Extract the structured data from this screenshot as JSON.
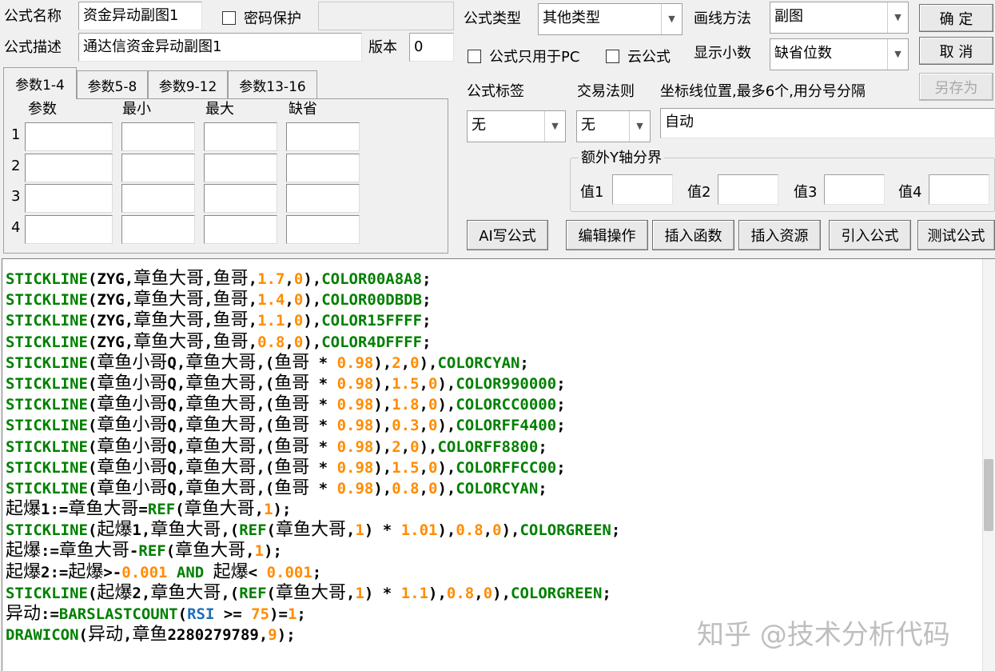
{
  "formula": {
    "name_label": "公式名称",
    "name_value": "资金异动副图1",
    "password_label": "密码保护",
    "password_value": "",
    "desc_label": "公式描述",
    "desc_value": "通达信资金异动副图1",
    "version_label": "版本",
    "version_value": "0"
  },
  "right_panel": {
    "type_label": "公式类型",
    "type_value": "其他类型",
    "draw_label": "画线方法",
    "draw_value": "副图",
    "pc_only_label": "公式只用于PC",
    "cloud_label": "云公式",
    "decimals_label": "显示小数",
    "decimals_value": "缺省位数",
    "tag_label": "公式标签",
    "tag_value": "无",
    "rule_label": "交易法则",
    "rule_value": "无",
    "axis_label": "坐标线位置,最多6个,用分号分隔",
    "axis_value": "自动",
    "extra_y_label": "额外Y轴分界",
    "val1": "值1",
    "val2": "值2",
    "val3": "值3",
    "val4": "值4"
  },
  "buttons": {
    "ok": "确  定",
    "cancel": "取  消",
    "save_as": "另存为",
    "ai": "AI写公式",
    "edit_ops": "编辑操作",
    "insert_func": "插入函数",
    "insert_res": "插入资源",
    "import": "引入公式",
    "test": "测试公式"
  },
  "tabs": [
    "参数1-4",
    "参数5-8",
    "参数9-12",
    "参数13-16"
  ],
  "params": {
    "headers": [
      "参数",
      "最小",
      "最大",
      "缺省"
    ],
    "rows": [
      "1",
      "2",
      "3",
      "4"
    ]
  },
  "code_lines": [
    [
      [
        "fn",
        "STICKLINE"
      ],
      [
        "sym",
        "(ZYG,"
      ],
      [
        "cn",
        "章鱼大哥"
      ],
      [
        "sym",
        ","
      ],
      [
        "cn",
        "鱼哥"
      ],
      [
        "sym",
        ","
      ],
      [
        "num",
        "1.7"
      ],
      [
        "sym",
        ","
      ],
      [
        "num",
        "0"
      ],
      [
        "sym",
        "),"
      ],
      [
        "fn",
        "COLOR00A8A8"
      ],
      [
        "sym",
        ";"
      ]
    ],
    [
      [
        "fn",
        "STICKLINE"
      ],
      [
        "sym",
        "(ZYG,"
      ],
      [
        "cn",
        "章鱼大哥"
      ],
      [
        "sym",
        ","
      ],
      [
        "cn",
        "鱼哥"
      ],
      [
        "sym",
        ","
      ],
      [
        "num",
        "1.4"
      ],
      [
        "sym",
        ","
      ],
      [
        "num",
        "0"
      ],
      [
        "sym",
        "),"
      ],
      [
        "fn",
        "COLOR00DBDB"
      ],
      [
        "sym",
        ";"
      ]
    ],
    [
      [
        "fn",
        "STICKLINE"
      ],
      [
        "sym",
        "(ZYG,"
      ],
      [
        "cn",
        "章鱼大哥"
      ],
      [
        "sym",
        ","
      ],
      [
        "cn",
        "鱼哥"
      ],
      [
        "sym",
        ","
      ],
      [
        "num",
        "1.1"
      ],
      [
        "sym",
        ","
      ],
      [
        "num",
        "0"
      ],
      [
        "sym",
        "),"
      ],
      [
        "fn",
        "COLOR15FFFF"
      ],
      [
        "sym",
        ";"
      ]
    ],
    [
      [
        "fn",
        "STICKLINE"
      ],
      [
        "sym",
        "(ZYG,"
      ],
      [
        "cn",
        "章鱼大哥"
      ],
      [
        "sym",
        ","
      ],
      [
        "cn",
        "鱼哥"
      ],
      [
        "sym",
        ","
      ],
      [
        "num",
        "0.8"
      ],
      [
        "sym",
        ","
      ],
      [
        "num",
        "0"
      ],
      [
        "sym",
        "),"
      ],
      [
        "fn",
        "COLOR4DFFFF"
      ],
      [
        "sym",
        ";"
      ]
    ],
    [
      [
        "fn",
        "STICKLINE"
      ],
      [
        "sym",
        "("
      ],
      [
        "cn",
        "章鱼小哥"
      ],
      [
        "sym",
        "Q,"
      ],
      [
        "cn",
        "章鱼大哥"
      ],
      [
        "sym",
        ",("
      ],
      [
        "cn",
        "鱼哥"
      ],
      [
        "sym",
        " * "
      ],
      [
        "num",
        "0.98"
      ],
      [
        "sym",
        "),"
      ],
      [
        "num",
        "2"
      ],
      [
        "sym",
        ","
      ],
      [
        "num",
        "0"
      ],
      [
        "sym",
        "),"
      ],
      [
        "fn",
        "COLORCYAN"
      ],
      [
        "sym",
        ";"
      ]
    ],
    [
      [
        "fn",
        "STICKLINE"
      ],
      [
        "sym",
        "("
      ],
      [
        "cn",
        "章鱼小哥"
      ],
      [
        "sym",
        "Q,"
      ],
      [
        "cn",
        "章鱼大哥"
      ],
      [
        "sym",
        ",("
      ],
      [
        "cn",
        "鱼哥"
      ],
      [
        "sym",
        " * "
      ],
      [
        "num",
        "0.98"
      ],
      [
        "sym",
        "),"
      ],
      [
        "num",
        "1.5"
      ],
      [
        "sym",
        ","
      ],
      [
        "num",
        "0"
      ],
      [
        "sym",
        "),"
      ],
      [
        "fn",
        "COLOR990000"
      ],
      [
        "sym",
        ";"
      ]
    ],
    [
      [
        "fn",
        "STICKLINE"
      ],
      [
        "sym",
        "("
      ],
      [
        "cn",
        "章鱼小哥"
      ],
      [
        "sym",
        "Q,"
      ],
      [
        "cn",
        "章鱼大哥"
      ],
      [
        "sym",
        ",("
      ],
      [
        "cn",
        "鱼哥"
      ],
      [
        "sym",
        " * "
      ],
      [
        "num",
        "0.98"
      ],
      [
        "sym",
        "),"
      ],
      [
        "num",
        "1.8"
      ],
      [
        "sym",
        ","
      ],
      [
        "num",
        "0"
      ],
      [
        "sym",
        "),"
      ],
      [
        "fn",
        "COLORCC0000"
      ],
      [
        "sym",
        ";"
      ]
    ],
    [
      [
        "fn",
        "STICKLINE"
      ],
      [
        "sym",
        "("
      ],
      [
        "cn",
        "章鱼小哥"
      ],
      [
        "sym",
        "Q,"
      ],
      [
        "cn",
        "章鱼大哥"
      ],
      [
        "sym",
        ",("
      ],
      [
        "cn",
        "鱼哥"
      ],
      [
        "sym",
        " * "
      ],
      [
        "num",
        "0.98"
      ],
      [
        "sym",
        "),"
      ],
      [
        "num",
        "0.3"
      ],
      [
        "sym",
        ","
      ],
      [
        "num",
        "0"
      ],
      [
        "sym",
        "),"
      ],
      [
        "fn",
        "COLORFF4400"
      ],
      [
        "sym",
        ";"
      ]
    ],
    [
      [
        "fn",
        "STICKLINE"
      ],
      [
        "sym",
        "("
      ],
      [
        "cn",
        "章鱼小哥"
      ],
      [
        "sym",
        "Q,"
      ],
      [
        "cn",
        "章鱼大哥"
      ],
      [
        "sym",
        ",("
      ],
      [
        "cn",
        "鱼哥"
      ],
      [
        "sym",
        " * "
      ],
      [
        "num",
        "0.98"
      ],
      [
        "sym",
        "),"
      ],
      [
        "num",
        "2"
      ],
      [
        "sym",
        ","
      ],
      [
        "num",
        "0"
      ],
      [
        "sym",
        "),"
      ],
      [
        "fn",
        "COLORFF8800"
      ],
      [
        "sym",
        ";"
      ]
    ],
    [
      [
        "fn",
        "STICKLINE"
      ],
      [
        "sym",
        "("
      ],
      [
        "cn",
        "章鱼小哥"
      ],
      [
        "sym",
        "Q,"
      ],
      [
        "cn",
        "章鱼大哥"
      ],
      [
        "sym",
        ",("
      ],
      [
        "cn",
        "鱼哥"
      ],
      [
        "sym",
        " * "
      ],
      [
        "num",
        "0.98"
      ],
      [
        "sym",
        "),"
      ],
      [
        "num",
        "1.5"
      ],
      [
        "sym",
        ","
      ],
      [
        "num",
        "0"
      ],
      [
        "sym",
        "),"
      ],
      [
        "fn",
        "COLORFFCC00"
      ],
      [
        "sym",
        ";"
      ]
    ],
    [
      [
        "fn",
        "STICKLINE"
      ],
      [
        "sym",
        "("
      ],
      [
        "cn",
        "章鱼小哥"
      ],
      [
        "sym",
        "Q,"
      ],
      [
        "cn",
        "章鱼大哥"
      ],
      [
        "sym",
        ",("
      ],
      [
        "cn",
        "鱼哥"
      ],
      [
        "sym",
        " * "
      ],
      [
        "num",
        "0.98"
      ],
      [
        "sym",
        "),"
      ],
      [
        "num",
        "0.8"
      ],
      [
        "sym",
        ","
      ],
      [
        "num",
        "0"
      ],
      [
        "sym",
        "),"
      ],
      [
        "fn",
        "COLORCYAN"
      ],
      [
        "sym",
        ";"
      ]
    ],
    [
      [
        "cn",
        "起爆"
      ],
      [
        "sym",
        "1:="
      ],
      [
        "cn",
        "章鱼大哥"
      ],
      [
        "sym",
        "="
      ],
      [
        "fn",
        "REF"
      ],
      [
        "sym",
        "("
      ],
      [
        "cn",
        "章鱼大哥"
      ],
      [
        "sym",
        ","
      ],
      [
        "num",
        "1"
      ],
      [
        "sym",
        ");"
      ]
    ],
    [
      [
        "fn",
        "STICKLINE"
      ],
      [
        "sym",
        "("
      ],
      [
        "cn",
        "起爆"
      ],
      [
        "sym",
        "1,"
      ],
      [
        "cn",
        "章鱼大哥"
      ],
      [
        "sym",
        ",("
      ],
      [
        "fn",
        "REF"
      ],
      [
        "sym",
        "("
      ],
      [
        "cn",
        "章鱼大哥"
      ],
      [
        "sym",
        ","
      ],
      [
        "num",
        "1"
      ],
      [
        "sym",
        ") * "
      ],
      [
        "num",
        "1.01"
      ],
      [
        "sym",
        "),"
      ],
      [
        "num",
        "0.8"
      ],
      [
        "sym",
        ","
      ],
      [
        "num",
        "0"
      ],
      [
        "sym",
        "),"
      ],
      [
        "fn",
        "COLORGREEN"
      ],
      [
        "sym",
        ";"
      ]
    ],
    [
      [
        "cn",
        "起爆"
      ],
      [
        "sym",
        ":="
      ],
      [
        "cn",
        "章鱼大哥"
      ],
      [
        "sym",
        "-"
      ],
      [
        "fn",
        "REF"
      ],
      [
        "sym",
        "("
      ],
      [
        "cn",
        "章鱼大哥"
      ],
      [
        "sym",
        ","
      ],
      [
        "num",
        "1"
      ],
      [
        "sym",
        ");"
      ]
    ],
    [
      [
        "cn",
        "起爆"
      ],
      [
        "sym",
        "2:="
      ],
      [
        "cn",
        "起爆"
      ],
      [
        "sym",
        ">-"
      ],
      [
        "num",
        "0.001"
      ],
      [
        "fn",
        " AND "
      ],
      [
        "cn",
        "起爆"
      ],
      [
        "sym",
        "< "
      ],
      [
        "num",
        "0.001"
      ],
      [
        "sym",
        ";"
      ]
    ],
    [
      [
        "fn",
        "STICKLINE"
      ],
      [
        "sym",
        "("
      ],
      [
        "cn",
        "起爆"
      ],
      [
        "sym",
        "2,"
      ],
      [
        "cn",
        "章鱼大哥"
      ],
      [
        "sym",
        ",("
      ],
      [
        "fn",
        "REF"
      ],
      [
        "sym",
        "("
      ],
      [
        "cn",
        "章鱼大哥"
      ],
      [
        "sym",
        ","
      ],
      [
        "num",
        "1"
      ],
      [
        "sym",
        ") * "
      ],
      [
        "num",
        "1.1"
      ],
      [
        "sym",
        "),"
      ],
      [
        "num",
        "0.8"
      ],
      [
        "sym",
        ","
      ],
      [
        "num",
        "0"
      ],
      [
        "sym",
        "),"
      ],
      [
        "fn",
        "COLORGREEN"
      ],
      [
        "sym",
        ";"
      ]
    ],
    [
      [
        "cn",
        "异动"
      ],
      [
        "sym",
        ":="
      ],
      [
        "fn",
        "BARSLASTCOUNT"
      ],
      [
        "sym",
        "("
      ],
      [
        "kw",
        "RSI"
      ],
      [
        "sym",
        " >= "
      ],
      [
        "num",
        "75"
      ],
      [
        "sym",
        ")="
      ],
      [
        "num",
        "1"
      ],
      [
        "sym",
        ";"
      ]
    ],
    [
      [
        "fn",
        "DRAWICON"
      ],
      [
        "sym",
        "("
      ],
      [
        "cn",
        "异动"
      ],
      [
        "sym",
        ","
      ],
      [
        "cn",
        "章鱼"
      ],
      [
        "sym",
        "2280279789,"
      ],
      [
        "num",
        "9"
      ],
      [
        "sym",
        ");"
      ]
    ]
  ],
  "watermark": "知乎 @技术分析代码"
}
